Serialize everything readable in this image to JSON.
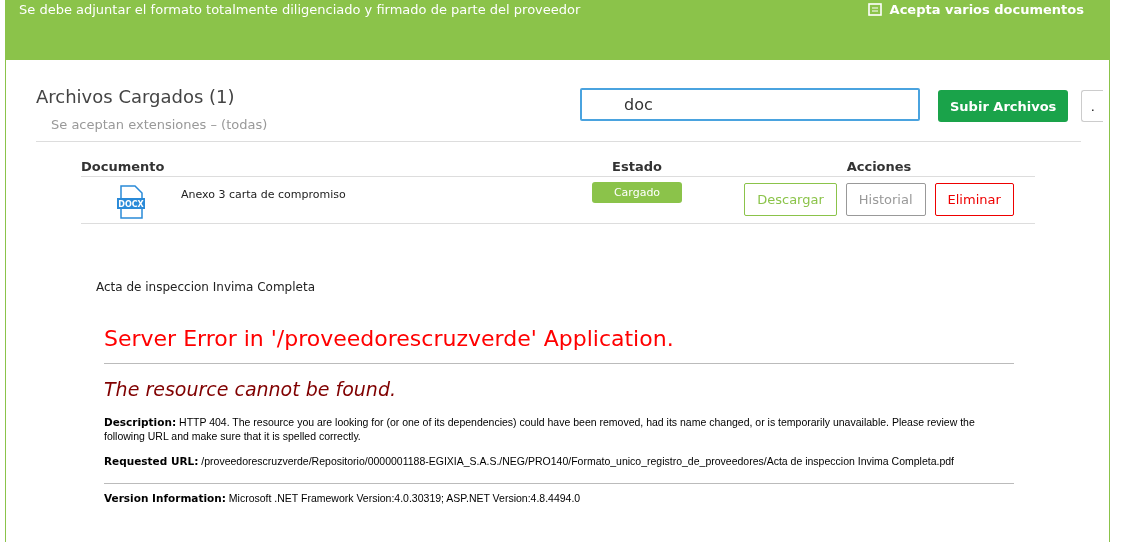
{
  "banner": {
    "note": "Se debe adjuntar el formato totalmente diligenciado y firmado de parte del proveedor",
    "multi_label": "Acepta varios documentos"
  },
  "files": {
    "title": "Archivos Cargados (1)",
    "extensions": "Se aceptan extensiones – (todas)",
    "search": {
      "value": "doc"
    },
    "upload_button": "Subir Archivos",
    "more_button": ".",
    "columns": [
      "Documento",
      "Estado",
      "Acciones"
    ],
    "rows": [
      {
        "file_type": "DOCX",
        "name": "Anexo 3 carta de compromiso",
        "status": "Cargado",
        "actions": [
          {
            "label": "Descargar",
            "kind": "download"
          },
          {
            "label": "Historial",
            "kind": "history"
          },
          {
            "label": "Eliminar",
            "kind": "delete"
          }
        ]
      }
    ]
  },
  "viewer": {
    "document_title": "Acta de inspeccion Invima Completa",
    "error_title": "Server Error in '/proveedorescruzverde' Application.",
    "error_subtitle": "The resource cannot be found.",
    "details": [
      "**Description:** HTTP 404. The resource you are looking for (or one of its dependencies) could have been removed, had its name changed, or is temporarily unavailable.  Please review the following URL and make sure that it is spelled correctly.",
      "**Requested URL:** /proveedorescruzverde/Repositorio/0000001188-EGIXIA_S.A.S./NEG/PRO140/Formato_unico_registro_de_proveedores/Acta de inspeccion Invima Completa.pdf"
    ],
    "version": "**Version Information:** Microsoft .NET Framework Version:4.0.30319; ASP.NET Version:4.8.4494.0"
  }
}
